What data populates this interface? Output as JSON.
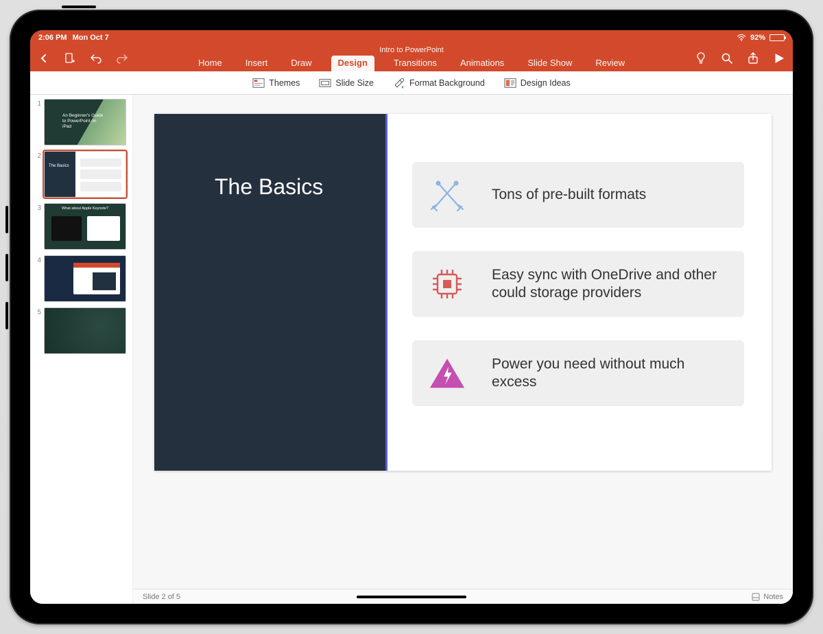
{
  "status": {
    "time": "2:06 PM",
    "date": "Mon Oct 7",
    "battery": "92%"
  },
  "header": {
    "doc_title": "Intro to PowerPoint",
    "tabs": {
      "home": "Home",
      "insert": "Insert",
      "draw": "Draw",
      "design": "Design",
      "transitions": "Transitions",
      "animations": "Animations",
      "slideshow": "Slide Show",
      "review": "Review"
    }
  },
  "ribbon": {
    "themes": "Themes",
    "slide_size": "Slide Size",
    "format_bg": "Format Background",
    "design_ideas": "Design Ideas"
  },
  "thumbs": [
    {
      "n": "1",
      "title": "An Beginner's Guide to PowerPoint on iPad"
    },
    {
      "n": "2",
      "title": "The Basics"
    },
    {
      "n": "3",
      "title": "What about Apple Keynote?"
    },
    {
      "n": "4",
      "title": ""
    },
    {
      "n": "5",
      "title": ""
    }
  ],
  "slide": {
    "title": "The Basics",
    "feat1": "Tons of pre-built formats",
    "feat2": "Easy sync with OneDrive and other could storage providers",
    "feat3": "Power you need without much excess"
  },
  "footer": {
    "slide_pos": "Slide 2 of 5",
    "notes": "Notes"
  }
}
